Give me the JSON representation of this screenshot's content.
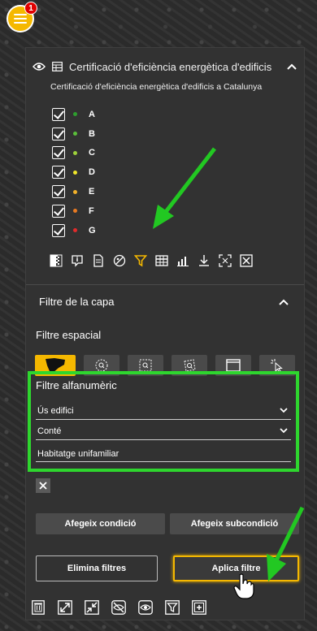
{
  "menu": {
    "badge": "1"
  },
  "layer": {
    "title": "Certificació d'eficiència energètica d'edificis",
    "subtitle": "Certificació d'eficiència energètica d'edificis a Catalunya",
    "legend": [
      {
        "label": "A",
        "color": "#2e9e2e"
      },
      {
        "label": "B",
        "color": "#5bbf3a"
      },
      {
        "label": "C",
        "color": "#9ed13a"
      },
      {
        "label": "D",
        "color": "#f0e62a"
      },
      {
        "label": "E",
        "color": "#f2b12a"
      },
      {
        "label": "F",
        "color": "#e97a22"
      },
      {
        "label": "G",
        "color": "#e22b2b"
      }
    ]
  },
  "filter": {
    "section_title": "Filtre de la capa",
    "spatial_label": "Filtre espacial",
    "alpha_label": "Filtre alfanumèric",
    "field_value": "Ús edifici",
    "operator_value": "Conté",
    "text_value": "Habitatge unifamiliar",
    "add_condition": "Afegeix condició",
    "add_subcondition": "Afegeix subcondició",
    "remove_filters": "Elimina filtres",
    "apply_filter": "Aplica filtre"
  },
  "colors": {
    "accent": "#f5b800",
    "highlight": "#2ed62e"
  }
}
